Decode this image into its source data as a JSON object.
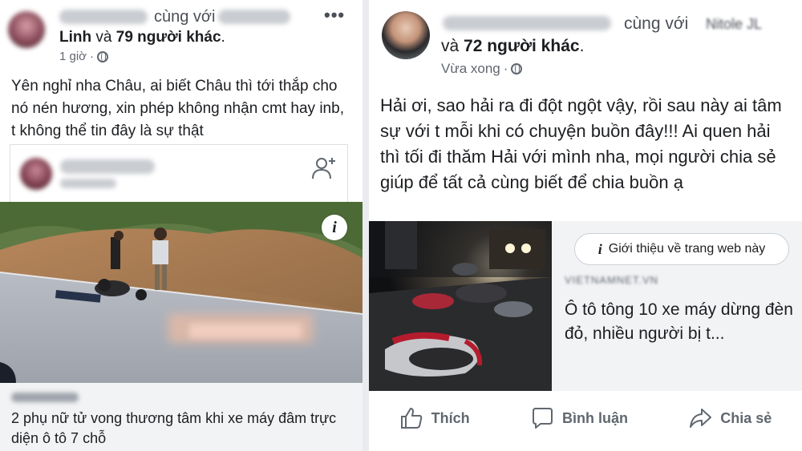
{
  "left_post": {
    "header_with": "cùng với",
    "header_tagged": "Linh",
    "header_and": "và",
    "header_others": "79 người khác",
    "header_period": ".",
    "timestamp": "1 giờ",
    "meta_sep": "·",
    "menu_icon": "more-icon",
    "text": "Yên nghỉ nha Châu, ai biết Châu thì tới thắp cho nó nén hương, xin phép không nhận cmt hay inb, t không thể tin đây là sự thật",
    "link_title": "2 phụ nữ tử vong thương tâm khi xe máy đâm trực diện ô tô 7 chỗ",
    "info_badge": "i"
  },
  "right_post": {
    "header_with": "cùng với",
    "header_tagged": "Nitole JL",
    "header_and": "và",
    "header_others": "72 người khác",
    "header_period": ".",
    "timestamp": "Vừa xong",
    "meta_sep": "·",
    "text": "Hải ơi, sao hải ra đi đột ngột vậy, rồi sau này ai tâm sự với t mỗi khi có chuyện buồn đây!!! Ai quen hải thì tối đi thăm Hải  với mình nha, mọi người chia sẻ giúp để tất cả cùng biết để chia buồn ạ",
    "about_site_label": "Giới thiệu về trang web này",
    "about_icon": "i",
    "link_domain": "VIETNAMNET.VN",
    "link_title": "Ô tô tông 10 xe máy dừng đèn đỏ, nhiều người bị t..."
  },
  "actions": {
    "like": "Thích",
    "comment": "Bình luận",
    "share": "Chia sẻ"
  },
  "colors": {
    "text": "#1c1e21",
    "secondary": "#606770",
    "link_bg": "#f2f3f5",
    "divider": "#e9ebee"
  }
}
